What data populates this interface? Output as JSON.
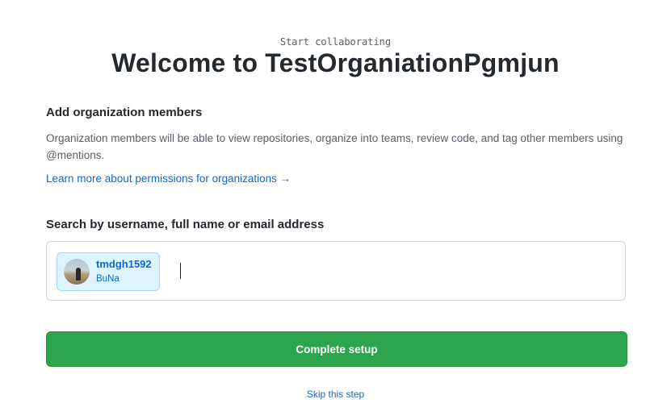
{
  "header": {
    "kicker": "Start collaborating",
    "title": "Welcome to TestOrganiationPgmjun"
  },
  "members_section": {
    "heading": "Add organization members",
    "description": "Organization members will be able to view repositories, organize into teams, review code, and tag other members using @mentions.",
    "learn_more_link": "Learn more about permissions for organizations →"
  },
  "search": {
    "label": "Search by username, full name or email address",
    "value": "",
    "selected_members": [
      {
        "username": "tmdgh1592",
        "full_name": "BuNa",
        "avatar_icon": "user-avatar-photo"
      }
    ]
  },
  "actions": {
    "complete_label": "Complete setup",
    "skip_label": "Skip this step"
  },
  "colors": {
    "primary_button": "#2da44e",
    "link": "#0969da",
    "chip_background": "#ddf4ff",
    "chip_border": "#a5d6ff",
    "border": "#d0d7de"
  }
}
